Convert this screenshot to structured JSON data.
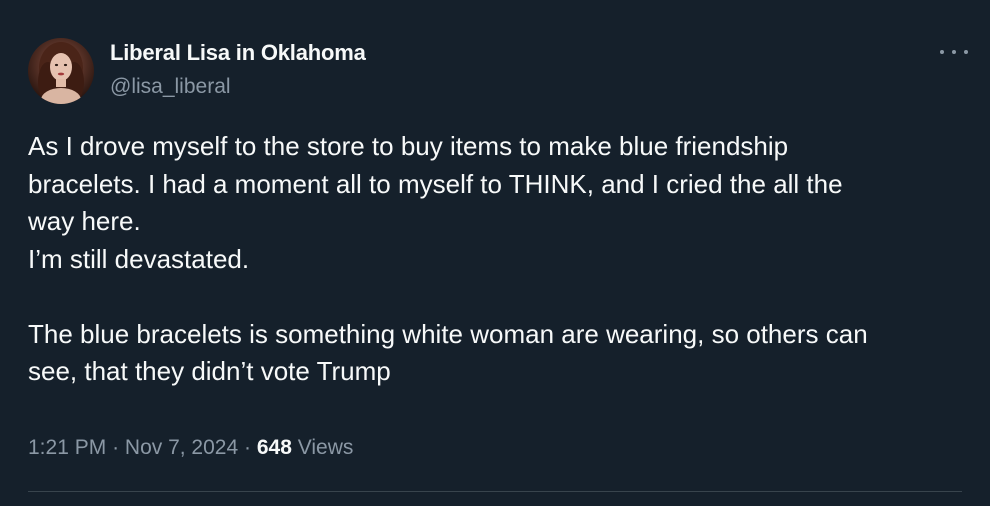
{
  "author": {
    "display_name": "Liberal Lisa in Oklahoma",
    "handle": "@lisa_liberal",
    "avatar_icon": "profile-photo"
  },
  "more_menu_icon": "more-horizontal-icon",
  "tweet": {
    "lines": [
      "As I drove myself to the store to buy items to make blue friendship",
      "bracelets. I had a moment all to myself to THINK, and I cried the all the",
      "way here.",
      "I’m still devastated.",
      "The blue bracelets is something white woman are wearing, so others can",
      "see, that they didn’t vote Trump"
    ]
  },
  "meta": {
    "time": "1:21 PM",
    "separator": "·",
    "date": "Nov 7, 2024",
    "views_count": "648",
    "views_label": "Views"
  },
  "colors": {
    "background": "#15202b",
    "text": "#f7f9f9",
    "muted": "#8b98a5",
    "divider": "#38444d"
  }
}
